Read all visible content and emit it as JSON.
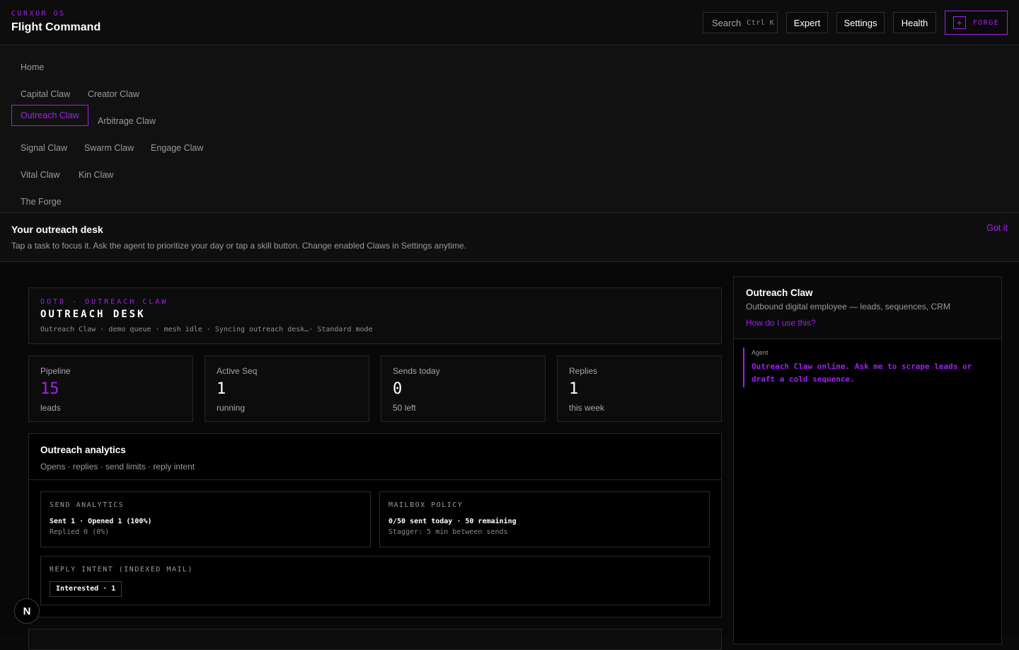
{
  "header": {
    "brand_sup": "CURXOR OS",
    "title": "Flight Command",
    "search_label": "Search",
    "search_kbd": "Ctrl K",
    "buttons": {
      "expert": "Expert",
      "settings": "Settings",
      "health": "Health",
      "forge": "FORGE",
      "forge_icon": "+"
    }
  },
  "nav": {
    "items": [
      {
        "label": "Home"
      },
      {
        "label": "Capital Claw"
      },
      {
        "label": "Creator Claw"
      },
      {
        "label": "Outreach Claw",
        "active": true
      },
      {
        "label": "Arbitrage Claw"
      },
      {
        "label": "Signal Claw"
      },
      {
        "label": "Swarm Claw"
      },
      {
        "label": "Engage Claw"
      },
      {
        "label": "Vital Claw"
      },
      {
        "label": "Kin Claw"
      },
      {
        "label": "The Forge"
      }
    ]
  },
  "notice": {
    "title": "Your outreach desk",
    "text": "Tap a task to focus it. Ask the agent to prioritize your day or tap a skill button. Change enabled Claws in Settings anytime.",
    "dismiss": "Got it"
  },
  "desk": {
    "sup": "OOTB · OUTREACH CLAW",
    "title": "OUTREACH DESK",
    "meta": "Outreach Claw · demo queue · mesh idle · Syncing outreach desk…· Standard mode"
  },
  "stats": [
    {
      "label": "Pipeline",
      "value": "15",
      "sub": "leads"
    },
    {
      "label": "Active Seq",
      "value": "1",
      "sub": "running"
    },
    {
      "label": "Sends today",
      "value": "0",
      "sub": "50 left"
    },
    {
      "label": "Replies",
      "value": "1",
      "sub": "this week"
    }
  ],
  "analytics": {
    "title": "Outreach analytics",
    "subtitle": "Opens · replies · send limits · reply intent",
    "send": {
      "label": "SEND ANALYTICS",
      "line1": "Sent 1 · Opened 1 (100%)",
      "line2": "Replied 0 (0%)"
    },
    "mailbox": {
      "label": "MAILBOX POLICY",
      "line1": "0/50 sent today · 50 remaining",
      "line2": "Stagger: 5 min between sends"
    },
    "intent": {
      "label": "REPLY INTENT (INDEXED MAIL)",
      "chip": "Interested · 1"
    }
  },
  "panel": {
    "title": "Outreach Claw",
    "subtitle": "Outbound digital employee — leads, sequences, CRM",
    "help_link": "How do I use this?",
    "message": {
      "role": "Agent",
      "text": "Outreach Claw online. Ask me to scrape leads or draft a cold sequence."
    }
  },
  "fab": {
    "label": "N"
  },
  "colors": {
    "accent": "#a020f0",
    "background": "#0a0a0a"
  }
}
